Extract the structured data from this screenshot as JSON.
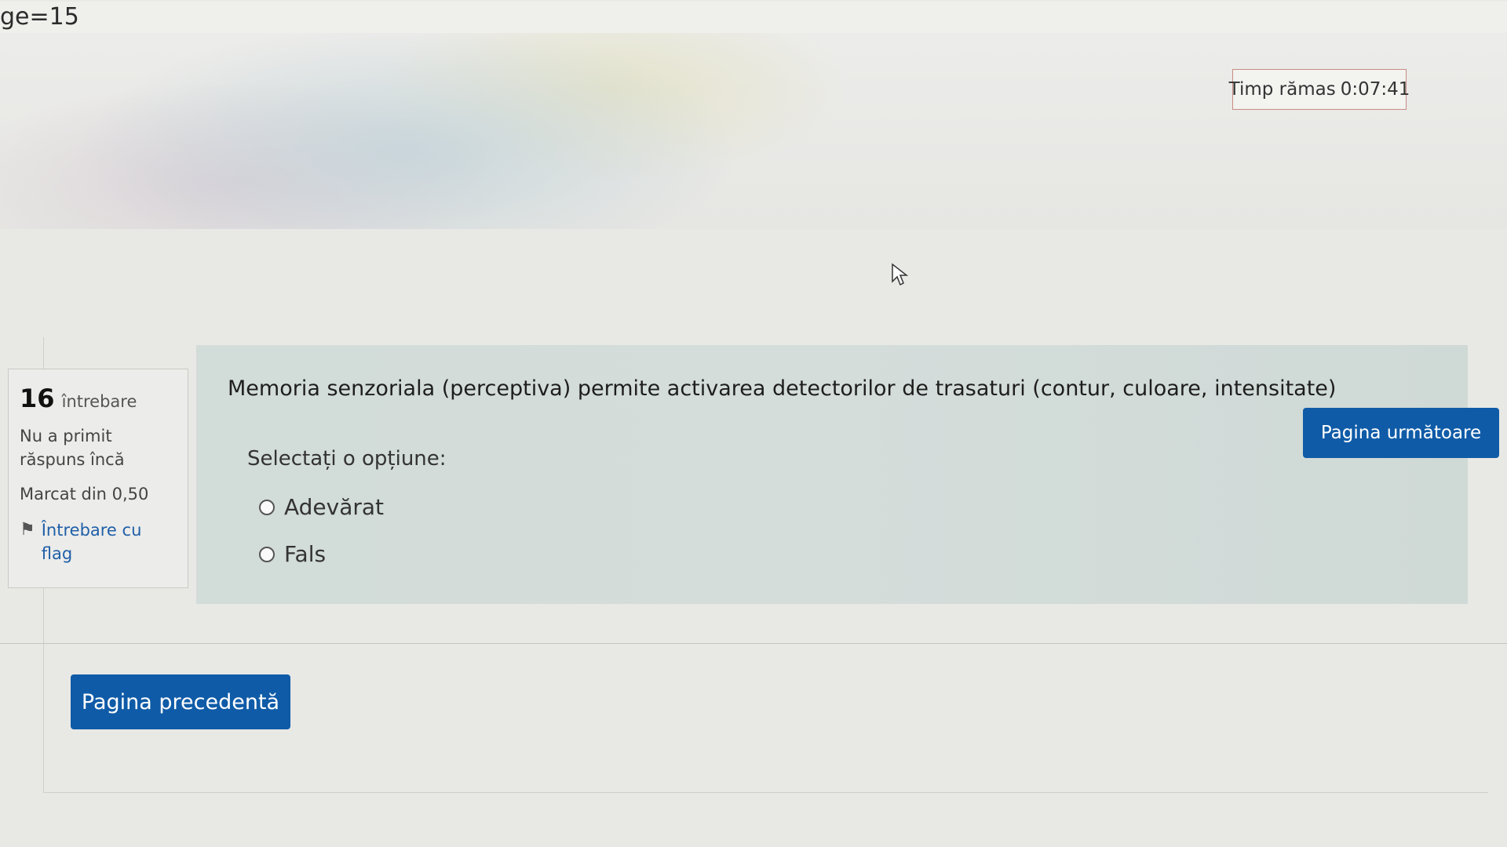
{
  "browser": {
    "url_fragment": "ge=15"
  },
  "quiz": {
    "timer_label": "Timp rămas",
    "timer_value": "0:07:41",
    "question_number": "16",
    "question_word": "întrebare",
    "status": "Nu a primit răspuns încă",
    "marks": "Marcat din 0,50",
    "flag_label": "Întrebare cu flag",
    "question_text": "Memoria senzoriala (perceptiva) permite activarea detectorilor de trasaturi (contur, culoare, intensitate)",
    "prompt": "Selectați o opțiune:",
    "options": [
      "Adevărat",
      "Fals"
    ],
    "selected_option": null
  },
  "navigation": {
    "next_label": "Pagina următoare",
    "prev_label": "Pagina precedentă"
  },
  "colors": {
    "primary_button": "#0f5ba7",
    "question_background": "#d2dcd8",
    "timer_border": "#c98c84",
    "flag_link": "#1f5fa8"
  },
  "icons": {
    "flag": "flag-icon",
    "cursor": "mouse-cursor-icon",
    "radio": "radio-button"
  }
}
